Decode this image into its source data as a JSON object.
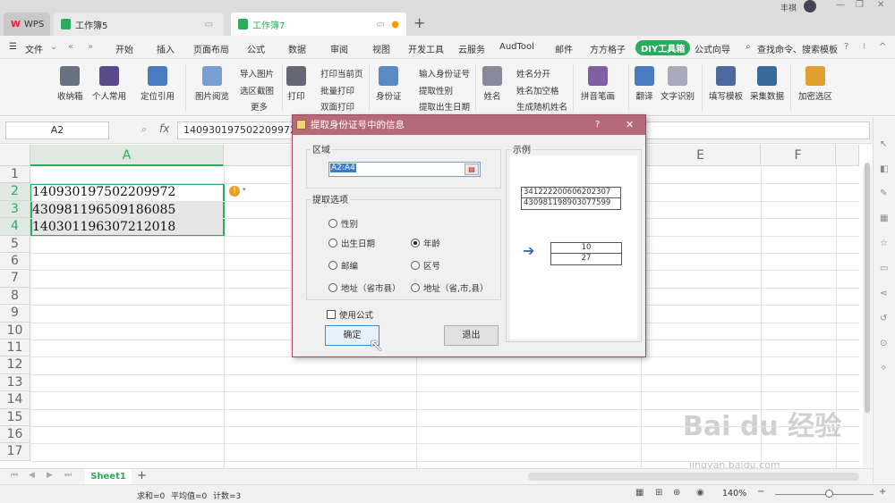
{
  "window": {
    "tabs": [
      {
        "label": "WPS"
      },
      {
        "label": "工作簿5"
      },
      {
        "label": "工作簿7"
      }
    ],
    "user": "丰祺",
    "add_tab": "+"
  },
  "menu": {
    "file": "文件",
    "items": [
      "开始",
      "插入",
      "页面布局",
      "公式",
      "数据",
      "审阅",
      "视图",
      "开发工具",
      "云服务",
      "AudTool",
      "邮件",
      "方方格子"
    ],
    "diy": "DIY工具箱",
    "formula_wizard": "公式向导",
    "search": "查找命令、搜索模板"
  },
  "ribbon": {
    "collect": "收纳箱",
    "personal": "个人常用",
    "locate": "定位引用",
    "picview": "图片阅览",
    "import_pic": "导入图片",
    "range_shot": "选区截图",
    "more": "更多",
    "print": "打印",
    "print_page": "打印当前页",
    "batch_print": "批量打印",
    "duplex": "双面打印",
    "idcard": "身份证",
    "input_id": "输入身份证号",
    "extract_gender": "提取性别",
    "extract_birth": "提取出生日期",
    "name": "姓名",
    "split_name": "姓名分开",
    "name_space": "姓名加空格",
    "random_name": "生成随机姓名",
    "pinyin": "拼音笔画",
    "translate": "翻译",
    "ocr": "文字识别",
    "fill_tpl": "填写模板",
    "collect_data": "采集数据",
    "encrypt": "加密选区"
  },
  "formula": {
    "cell_ref": "A2",
    "fx": "fx",
    "value": "140930197502209972"
  },
  "sheet": {
    "columns": [
      "A",
      "E",
      "F"
    ],
    "rows": [
      "1",
      "2",
      "3",
      "4",
      "5",
      "6",
      "7",
      "8",
      "9",
      "10",
      "11",
      "12",
      "13",
      "14",
      "15",
      "16",
      "17"
    ],
    "cells": [
      "140930197502209972",
      "430981196509186085",
      "140301196307212018"
    ],
    "tab": "Sheet1"
  },
  "status": {
    "sum": "求和=0",
    "avg": "平均值=0",
    "count": "计数=3",
    "zoom": "140%"
  },
  "dialog": {
    "title": "提取身份证号中的信息",
    "help": "?",
    "close": "✕",
    "area_label": "区域",
    "area_value": "A2:A4",
    "options_label": "提取选项",
    "options": [
      {
        "label": "性别",
        "checked": false
      },
      {
        "label": "出生日期",
        "checked": false
      },
      {
        "label": "年龄",
        "checked": true
      },
      {
        "label": "邮编",
        "checked": false
      },
      {
        "label": "区号",
        "checked": false
      },
      {
        "label": "地址（省市县）",
        "checked": false
      },
      {
        "label": "地址（省,市,县）",
        "checked": false
      }
    ],
    "use_formula": "使用公式",
    "ok": "确定",
    "exit": "退出",
    "example_label": "示例",
    "example_in": [
      "341222200606202307",
      "430981198903077599"
    ],
    "example_out": [
      "10",
      "27"
    ]
  },
  "watermark": {
    "brand": "Bai du 经验",
    "url": "jingyan.baidu.com"
  }
}
